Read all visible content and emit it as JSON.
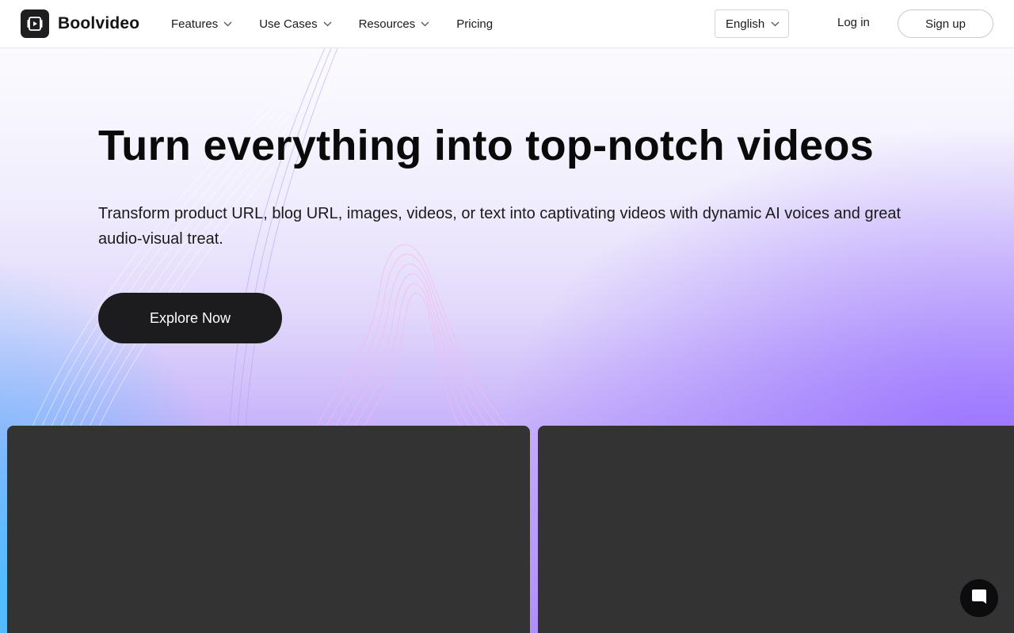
{
  "brand": {
    "name": "Boolvideo",
    "logo_icon": "video-frame-icon"
  },
  "nav": {
    "items": [
      {
        "label": "Features",
        "has_dropdown": true
      },
      {
        "label": "Use Cases",
        "has_dropdown": true
      },
      {
        "label": "Resources",
        "has_dropdown": true
      },
      {
        "label": "Pricing",
        "has_dropdown": false
      }
    ]
  },
  "header": {
    "language": "English",
    "login_label": "Log in",
    "signup_label": "Sign up"
  },
  "hero": {
    "title": "Turn everything into top-notch videos",
    "subtitle": "Transform product URL, blog URL, images, videos, or text into captivating videos with dynamic AI voices and great audio-visual treat.",
    "cta_label": "Explore Now"
  },
  "chat_widget": {
    "icon": "chat-bubble-icon"
  },
  "colors": {
    "cta_background": "#1c1c1e",
    "panel_background": "#333333",
    "gradient_blue": "#40c4ff",
    "gradient_purple": "#966eff"
  }
}
